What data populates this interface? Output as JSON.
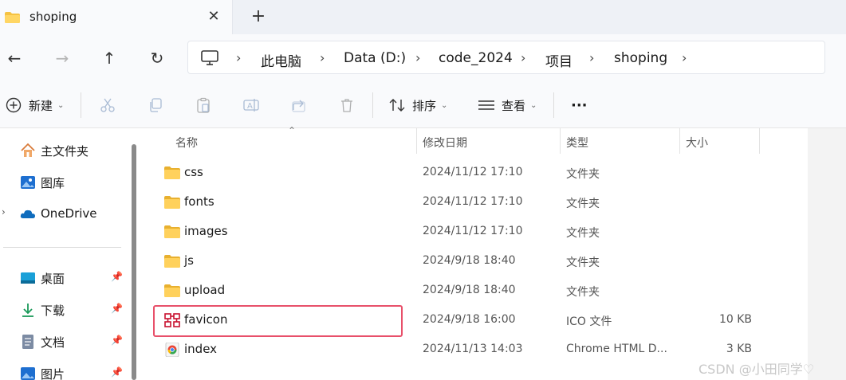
{
  "tab": {
    "title": "shoping",
    "close": "✕",
    "new_tab": "+"
  },
  "nav": {
    "back": "←",
    "forward": "→",
    "up": "↑",
    "refresh": "↻"
  },
  "breadcrumbs": [
    "此电脑",
    "Data (D:)",
    "code_2024",
    "项目",
    "shoping"
  ],
  "breadcrumb_sep": "›",
  "toolbar": {
    "new_label": "新建",
    "sort_label": "排序",
    "view_label": "查看",
    "more": "···"
  },
  "sidebar": {
    "items": [
      {
        "label": "主文件夹",
        "icon": "home-icon"
      },
      {
        "label": "图库",
        "icon": "gallery-icon"
      },
      {
        "label": "OneDrive",
        "icon": "cloud-icon"
      },
      {
        "label": "桌面",
        "icon": "desktop-icon",
        "pinned": true
      },
      {
        "label": "下载",
        "icon": "download-icon",
        "pinned": true
      },
      {
        "label": "文档",
        "icon": "document-icon",
        "pinned": true
      },
      {
        "label": "图片",
        "icon": "pictures-icon",
        "pinned": true
      }
    ]
  },
  "columns": {
    "name": "名称",
    "date": "修改日期",
    "type": "类型",
    "size": "大小"
  },
  "files": [
    {
      "name": "css",
      "date": "2024/11/12 17:10",
      "type": "文件夹",
      "size": "",
      "icon": "folder-icon"
    },
    {
      "name": "fonts",
      "date": "2024/11/12 17:10",
      "type": "文件夹",
      "size": "",
      "icon": "folder-icon"
    },
    {
      "name": "images",
      "date": "2024/11/12 17:10",
      "type": "文件夹",
      "size": "",
      "icon": "folder-icon"
    },
    {
      "name": "js",
      "date": "2024/9/18 18:40",
      "type": "文件夹",
      "size": "",
      "icon": "folder-icon"
    },
    {
      "name": "upload",
      "date": "2024/9/18 18:40",
      "type": "文件夹",
      "size": "",
      "icon": "folder-icon"
    },
    {
      "name": "favicon",
      "date": "2024/9/18 16:00",
      "type": "ICO 文件",
      "size": "10 KB",
      "icon": "ico-file-icon",
      "highlighted": true
    },
    {
      "name": "index",
      "date": "2024/11/13 14:03",
      "type": "Chrome HTML D...",
      "size": "3 KB",
      "icon": "chrome-html-icon"
    }
  ],
  "watermark": "CSDN @小田同学♡",
  "colors": {
    "folder": "#f5c242",
    "highlight": "#e8506a",
    "accent": "#0067c0"
  }
}
